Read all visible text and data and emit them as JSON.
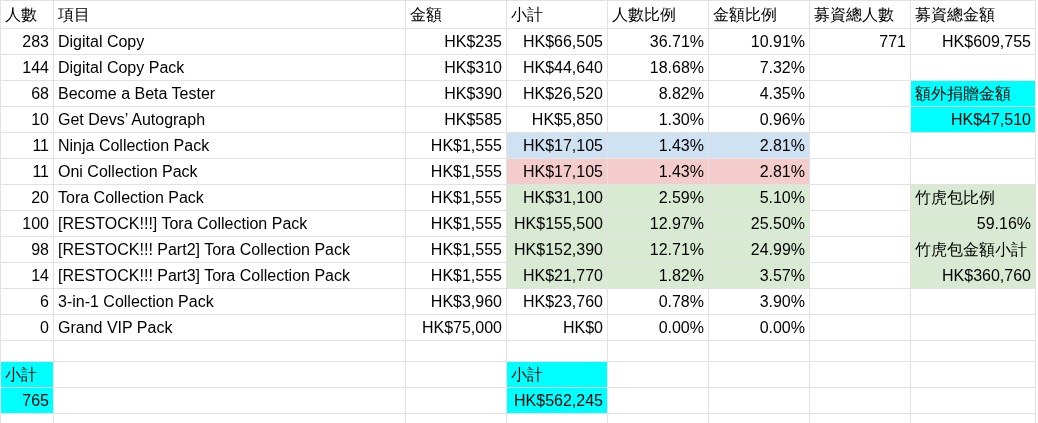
{
  "sheet": {
    "rows": [
      {
        "cells": [
          {
            "text": "人數",
            "kind": "text"
          },
          {
            "text": "項目",
            "kind": "text"
          },
          {
            "text": "金額",
            "kind": "text"
          },
          {
            "text": "小計",
            "kind": "text"
          },
          {
            "text": "人數比例",
            "kind": "text"
          },
          {
            "text": "金額比例",
            "kind": "text"
          },
          {
            "text": "募資總人數",
            "kind": "text"
          },
          {
            "text": "募資總金額",
            "kind": "text"
          }
        ]
      },
      {
        "cells": [
          {
            "text": "283",
            "kind": "number"
          },
          {
            "text": "Digital Copy",
            "kind": "text"
          },
          {
            "text": "HK$235",
            "kind": "number"
          },
          {
            "text": "HK$66,505",
            "kind": "number"
          },
          {
            "text": "36.71%",
            "kind": "number"
          },
          {
            "text": "10.91%",
            "kind": "number"
          },
          {
            "text": "771",
            "kind": "number"
          },
          {
            "text": "HK$609,755",
            "kind": "number"
          }
        ]
      },
      {
        "cells": [
          {
            "text": "144",
            "kind": "number"
          },
          {
            "text": "Digital Copy Pack",
            "kind": "text"
          },
          {
            "text": "HK$310",
            "kind": "number"
          },
          {
            "text": "HK$44,640",
            "kind": "number"
          },
          {
            "text": "18.68%",
            "kind": "number"
          },
          {
            "text": "7.32%",
            "kind": "number"
          },
          null,
          null
        ]
      },
      {
        "cells": [
          {
            "text": "68",
            "kind": "number"
          },
          {
            "text": "Become a Beta Tester",
            "kind": "text"
          },
          {
            "text": "HK$390",
            "kind": "number"
          },
          {
            "text": "HK$26,520",
            "kind": "number"
          },
          {
            "text": "8.82%",
            "kind": "number"
          },
          {
            "text": "4.35%",
            "kind": "number"
          },
          null,
          {
            "text": "額外捐贈金額",
            "kind": "text",
            "color": "#00ffff"
          }
        ]
      },
      {
        "cells": [
          {
            "text": "10",
            "kind": "number"
          },
          {
            "text": "Get Devs’ Autograph",
            "kind": "text"
          },
          {
            "text": "HK$585",
            "kind": "number"
          },
          {
            "text": "HK$5,850",
            "kind": "number"
          },
          {
            "text": "1.30%",
            "kind": "number"
          },
          {
            "text": "0.96%",
            "kind": "number"
          },
          null,
          {
            "text": "HK$47,510",
            "kind": "number",
            "color": "#00ffff"
          }
        ]
      },
      {
        "cells": [
          {
            "text": "11",
            "kind": "number"
          },
          {
            "text": "Ninja Collection Pack",
            "kind": "text"
          },
          {
            "text": "HK$1,555",
            "kind": "number"
          },
          {
            "text": "HK$17,105",
            "kind": "number",
            "color": "#cfe2f3"
          },
          {
            "text": "1.43%",
            "kind": "number",
            "color": "#cfe2f3"
          },
          {
            "text": "2.81%",
            "kind": "number",
            "color": "#cfe2f3"
          },
          null,
          null
        ]
      },
      {
        "cells": [
          {
            "text": "11",
            "kind": "number"
          },
          {
            "text": "Oni Collection Pack",
            "kind": "text"
          },
          {
            "text": "HK$1,555",
            "kind": "number"
          },
          {
            "text": "HK$17,105",
            "kind": "number",
            "color": "#f4cccc"
          },
          {
            "text": "1.43%",
            "kind": "number",
            "color": "#f4cccc"
          },
          {
            "text": "2.81%",
            "kind": "number",
            "color": "#f4cccc"
          },
          null,
          null
        ]
      },
      {
        "cells": [
          {
            "text": "20",
            "kind": "number"
          },
          {
            "text": "Tora Collection Pack",
            "kind": "text"
          },
          {
            "text": "HK$1,555",
            "kind": "number"
          },
          {
            "text": "HK$31,100",
            "kind": "number",
            "color": "#d9ead3"
          },
          {
            "text": "2.59%",
            "kind": "number",
            "color": "#d9ead3"
          },
          {
            "text": "5.10%",
            "kind": "number",
            "color": "#d9ead3"
          },
          null,
          {
            "text": "竹虎包比例",
            "kind": "text",
            "color": "#d9ead3"
          }
        ]
      },
      {
        "cells": [
          {
            "text": "100",
            "kind": "number"
          },
          {
            "text": "[RESTOCK!!!] Tora Collection Pack",
            "kind": "text"
          },
          {
            "text": "HK$1,555",
            "kind": "number"
          },
          {
            "text": "HK$155,500",
            "kind": "number",
            "color": "#d9ead3"
          },
          {
            "text": "12.97%",
            "kind": "number",
            "color": "#d9ead3"
          },
          {
            "text": "25.50%",
            "kind": "number",
            "color": "#d9ead3"
          },
          null,
          {
            "text": "59.16%",
            "kind": "number",
            "color": "#d9ead3"
          }
        ]
      },
      {
        "cells": [
          {
            "text": "98",
            "kind": "number"
          },
          {
            "text": "[RESTOCK!!! Part2] Tora Collection Pack",
            "kind": "text"
          },
          {
            "text": "HK$1,555",
            "kind": "number"
          },
          {
            "text": "HK$152,390",
            "kind": "number",
            "color": "#d9ead3"
          },
          {
            "text": "12.71%",
            "kind": "number",
            "color": "#d9ead3"
          },
          {
            "text": "24.99%",
            "kind": "number",
            "color": "#d9ead3"
          },
          null,
          {
            "text": "竹虎包金額小計",
            "kind": "text",
            "color": "#d9ead3"
          }
        ]
      },
      {
        "cells": [
          {
            "text": "14",
            "kind": "number"
          },
          {
            "text": "[RESTOCK!!! Part3] Tora Collection Pack",
            "kind": "text"
          },
          {
            "text": "HK$1,555",
            "kind": "number"
          },
          {
            "text": "HK$21,770",
            "kind": "number",
            "color": "#d9ead3"
          },
          {
            "text": "1.82%",
            "kind": "number",
            "color": "#d9ead3"
          },
          {
            "text": "3.57%",
            "kind": "number",
            "color": "#d9ead3"
          },
          null,
          {
            "text": "HK$360,760",
            "kind": "number",
            "color": "#d9ead3"
          }
        ]
      },
      {
        "cells": [
          {
            "text": "6",
            "kind": "number"
          },
          {
            "text": "3-in-1 Collection Pack",
            "kind": "text"
          },
          {
            "text": "HK$3,960",
            "kind": "number"
          },
          {
            "text": "HK$23,760",
            "kind": "number"
          },
          {
            "text": "0.78%",
            "kind": "number"
          },
          {
            "text": "3.90%",
            "kind": "number"
          },
          null,
          null
        ]
      },
      {
        "cells": [
          {
            "text": "0",
            "kind": "number"
          },
          {
            "text": "Grand VIP Pack",
            "kind": "text"
          },
          {
            "text": "HK$75,000",
            "kind": "number"
          },
          {
            "text": "HK$0",
            "kind": "number"
          },
          {
            "text": "0.00%",
            "kind": "number"
          },
          {
            "text": "0.00%",
            "kind": "number"
          },
          null,
          null
        ]
      },
      {
        "cells": [
          null,
          null,
          null,
          null,
          null,
          null,
          null,
          null
        ]
      },
      {
        "cells": [
          {
            "text": "小計",
            "kind": "text",
            "color": "#00ffff"
          },
          null,
          null,
          {
            "text": "小計",
            "kind": "text",
            "color": "#00ffff"
          },
          null,
          null,
          null,
          null
        ]
      },
      {
        "cells": [
          {
            "text": "765",
            "kind": "number",
            "color": "#00ffff"
          },
          null,
          null,
          {
            "text": "HK$562,245",
            "kind": "number",
            "color": "#00ffff"
          },
          null,
          null,
          null,
          null
        ]
      }
    ]
  }
}
